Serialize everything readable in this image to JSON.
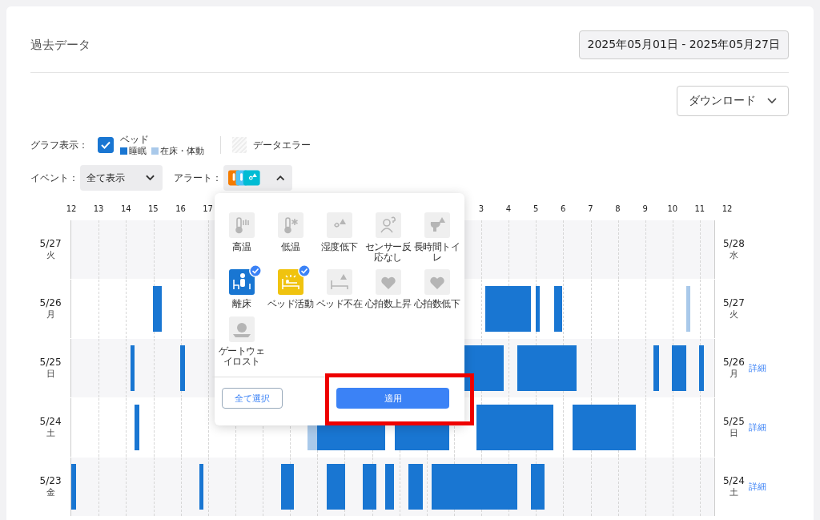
{
  "title": "過去データ",
  "date_range": "2025年05月01日 - 2025年05月27日",
  "download": {
    "label": "ダウンロード"
  },
  "graph_display": {
    "label": "グラフ表示：",
    "bed": {
      "label": "ベッド",
      "checked": true
    },
    "legend": [
      {
        "label": "睡眠",
        "kind": "sleep"
      },
      {
        "label": "在床・体動",
        "kind": "inbed"
      }
    ],
    "data_error": "データエラー"
  },
  "event": {
    "label": "イベント：",
    "value": "全て表示"
  },
  "alert": {
    "label": "アラート：",
    "expanded": true
  },
  "timeline": {
    "axis_ticks": [
      "12",
      "13",
      "14",
      "15",
      "16",
      "17",
      "3",
      "4",
      "5",
      "6",
      "7",
      "8",
      "9",
      "10",
      "11",
      "12"
    ],
    "rows": [
      {
        "date": "5/27",
        "weekday": "火",
        "end_date": "5/28",
        "end_weekday": "水"
      },
      {
        "date": "5/26",
        "weekday": "月",
        "end_date": "5/27",
        "end_weekday": "火"
      },
      {
        "date": "5/25",
        "weekday": "日",
        "end_date": "5/26",
        "end_weekday": "月",
        "detail": "詳細"
      },
      {
        "date": "5/24",
        "weekday": "土",
        "end_date": "5/25",
        "end_weekday": "日",
        "detail": "詳細"
      },
      {
        "date": "5/23",
        "weekday": "金",
        "end_date": "5/24",
        "end_weekday": "土",
        "detail": "詳細"
      }
    ]
  },
  "alert_menu": {
    "items": [
      {
        "label": "高温",
        "selected": false
      },
      {
        "label": "低温",
        "selected": false
      },
      {
        "label": "湿度低下",
        "selected": false
      },
      {
        "label": "センサー反応なし",
        "selected": false
      },
      {
        "label": "長時間トイレ",
        "selected": false
      },
      {
        "label": "離床",
        "selected": true,
        "color": "#1976d2"
      },
      {
        "label": "ベッド活動",
        "selected": true,
        "color": "#f0c30f"
      },
      {
        "label": "ベッド不在",
        "selected": false
      },
      {
        "label": "心拍数上昇",
        "selected": false
      },
      {
        "label": "心拍数低下",
        "selected": false
      },
      {
        "label": "ゲートウェイロスト",
        "selected": false
      }
    ],
    "select_all": "全て選択",
    "apply": "適用"
  }
}
